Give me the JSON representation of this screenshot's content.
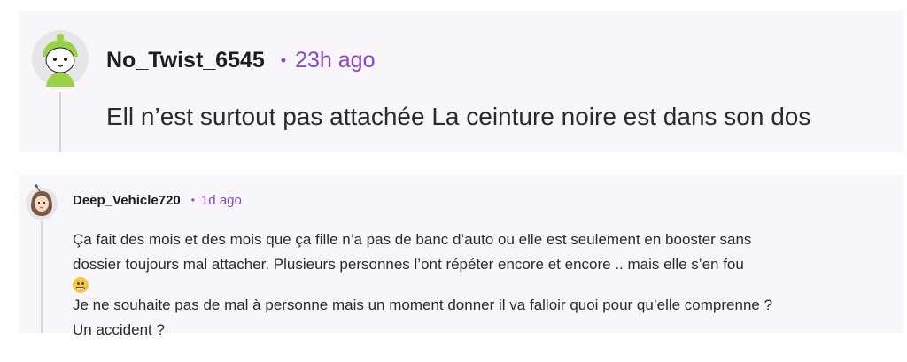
{
  "comments": [
    {
      "username": "No_Twist_6545",
      "separator": "•",
      "time": "23h ago",
      "text": "Ell n’est surtout pas attachée La ceinture noire est dans son dos"
    },
    {
      "username": "Deep_Vehicle720",
      "separator": "•",
      "time": "1d ago",
      "lines": [
        "Ça fait des mois et des mois que ça fille n’a pas de banc d’auto ou elle est seulement en booster sans",
        "dossier toujours mal attacher. Plusieurs personnes l’ont répéter encore et encore .. mais elle s’en fou",
        "Je ne souhaite pas de mal à personne mais un moment donner il va falloir quoi pour qu’elle comprenne ?",
        "Un accident ?"
      ],
      "emoji": "grimacing-face-emoji"
    }
  ],
  "colors": {
    "card_bg": "#f8f6fa",
    "accent_purple": "#8a46c8",
    "thread_line": "#d9d3e6"
  }
}
